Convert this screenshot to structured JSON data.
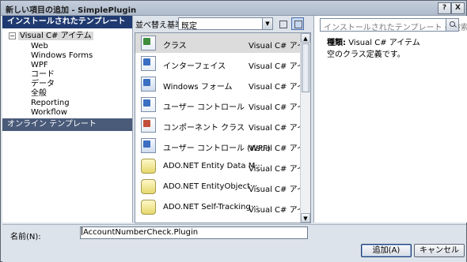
{
  "window": {
    "title": "新しい項目の追加 - SimplePlugin",
    "help_label": "?",
    "close_label": "X"
  },
  "left": {
    "header": "インストールされたテンプレート",
    "root_label": "Visual C# アイテム",
    "root_toggle": "−",
    "children": [
      "Web",
      "Windows Forms",
      "WPF",
      "コード",
      "データ",
      "全般",
      "Reporting",
      "Workflow"
    ],
    "online": "オンライン テンプレート"
  },
  "toolbar": {
    "sort_label": "並べ替え基準:",
    "sort_value": "既定",
    "dropdown_glyph": "▼"
  },
  "items": [
    {
      "name": "クラス",
      "category": "Visual C# アイテム",
      "icon": "class-icon"
    },
    {
      "name": "インターフェイス",
      "category": "Visual C# アイテム",
      "icon": "interface-icon"
    },
    {
      "name": "Windows フォーム",
      "category": "Visual C# アイテム",
      "icon": "windows-form-icon"
    },
    {
      "name": "ユーザー コントロール",
      "category": "Visual C# アイテム",
      "icon": "user-control-icon"
    },
    {
      "name": "コンポーネント クラス",
      "category": "Visual C# アイテム",
      "icon": "component-class-icon"
    },
    {
      "name": "ユーザー コントロール (WPF)",
      "category": "Visual C# アイテム",
      "icon": "wpf-user-control-icon"
    },
    {
      "name": "ADO.NET Entity Data M···",
      "category": "Visual C# アイテム",
      "icon": "entity-data-model-icon"
    },
    {
      "name": "ADO.NET EntityObject···",
      "category": "Visual C# アイテム",
      "icon": "entityobject-generator-icon"
    },
    {
      "name": "ADO.NET Self-Tracking···",
      "category": "Visual C# アイテム",
      "icon": "self-tracking-entity-icon"
    }
  ],
  "scroll": {
    "up": "▲",
    "down": "▼"
  },
  "details": {
    "search_placeholder": "インストールされたテンプレート の検索",
    "type_label": "種類:",
    "type_value": "Visual C# アイテム",
    "description": "空のクラス定義です。"
  },
  "bottom": {
    "name_label": "名前(N):",
    "name_value": "AccountNumberCheck.Plugin",
    "add_label": "追加(A)",
    "cancel_label": "キャンセル"
  }
}
